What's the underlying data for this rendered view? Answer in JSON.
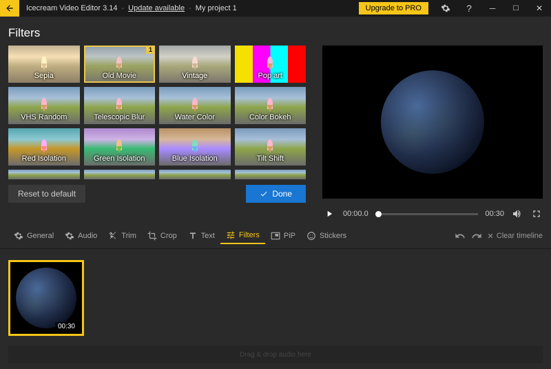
{
  "titlebar": {
    "app_name": "Icecream Video Editor 3.14",
    "update_text": "Update available",
    "project_name": "My project 1",
    "upgrade_label": "Upgrade to PRO"
  },
  "header": {
    "title": "Filters"
  },
  "filters": {
    "items": [
      {
        "label": "Sepia",
        "cls": "sepia"
      },
      {
        "label": "Old Movie",
        "cls": "old",
        "selected": true,
        "badge": "1"
      },
      {
        "label": "Vintage",
        "cls": "vintage"
      },
      {
        "label": "Pop art",
        "cls": "popart"
      },
      {
        "label": "VHS Random",
        "cls": ""
      },
      {
        "label": "Telescopic Blur",
        "cls": ""
      },
      {
        "label": "Water Color",
        "cls": ""
      },
      {
        "label": "Color Bokeh",
        "cls": ""
      },
      {
        "label": "Red Isolation",
        "cls": "red"
      },
      {
        "label": "Green Isolation",
        "cls": "green"
      },
      {
        "label": "Blue Isolation",
        "cls": "blue"
      },
      {
        "label": "Tilt Shift",
        "cls": ""
      }
    ],
    "reset_label": "Reset to default",
    "done_label": "Done"
  },
  "preview": {
    "current_time": "00:00.0",
    "total_time": "00:30"
  },
  "toolbar": {
    "tabs": [
      {
        "label": "General",
        "icon": "gear-icon"
      },
      {
        "label": "Audio",
        "icon": "gear-icon"
      },
      {
        "label": "Trim",
        "icon": "scissors-icon"
      },
      {
        "label": "Crop",
        "icon": "crop-icon"
      },
      {
        "label": "Text",
        "icon": "text-icon"
      },
      {
        "label": "Filters",
        "icon": "filters-icon",
        "active": true
      },
      {
        "label": "PiP",
        "icon": "pip-icon"
      },
      {
        "label": "Stickers",
        "icon": "stickers-icon"
      }
    ],
    "clear_label": "Clear timeline"
  },
  "timeline": {
    "clip_duration": "00:30",
    "audio_hint": "Drag & drop audio here"
  }
}
